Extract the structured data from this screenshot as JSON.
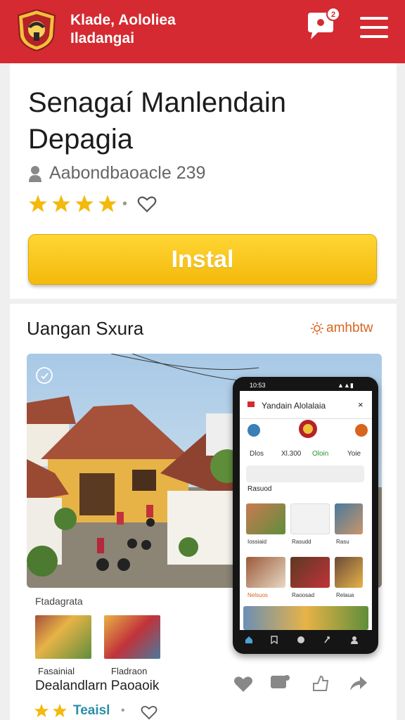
{
  "header": {
    "brand_line1": "Klade, Aololiea",
    "brand_line2": "Iladangai",
    "colors": {
      "primary": "#d52a31",
      "gold": "#f4b90c"
    },
    "icons": [
      "logo-emblem",
      "chat-notification-icon",
      "hamburger-menu-icon"
    ]
  },
  "app": {
    "title": "Senagaí Manlendain Depagia",
    "developer": "Aabondbaoacle 239",
    "rating_stars": 4,
    "install_label": "Instal"
  },
  "screenshots": {
    "section_title": "Uangan Sxura",
    "section_link": "amhbtw",
    "phone": {
      "status_left": "10:53",
      "app_title": "Yandain Alolalaia",
      "close": "×",
      "tabs": [
        "Dlos",
        "Xl.300",
        "Oloin",
        "Yoie"
      ],
      "section": "Rasuod",
      "labels": [
        "Iossiaid",
        "Rasudd",
        "Rasu",
        "Nelsuos",
        "Raoosad",
        "Relaua"
      ]
    },
    "sub_label": "Ftadagrata",
    "thumb_captions": [
      "Fasainial",
      "Fladraon"
    ],
    "item_title": "Dealandlarn Paoaoik",
    "item_rating_stars": 2,
    "item_rating_text": "Teaisl"
  }
}
